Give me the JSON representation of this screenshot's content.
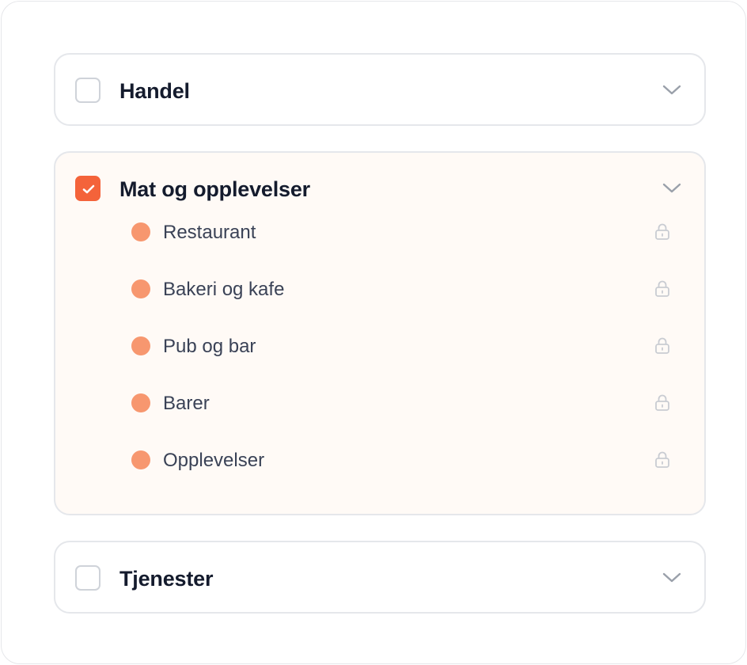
{
  "groups": [
    {
      "title": "Handel",
      "checked": false,
      "expanded": false
    },
    {
      "title": "Mat og opplevelser",
      "checked": true,
      "expanded": true,
      "items": [
        {
          "label": "Restaurant"
        },
        {
          "label": "Bakeri og kafe"
        },
        {
          "label": "Pub og bar"
        },
        {
          "label": "Barer"
        },
        {
          "label": "Opplevelser"
        }
      ]
    },
    {
      "title": "Tjenester",
      "checked": false,
      "expanded": false
    }
  ],
  "icons": {
    "checkbox": "checkbox-icon",
    "check": "check-icon",
    "chevron": "chevron-down-icon",
    "lock": "lock-icon",
    "dot": "category-dot-icon"
  },
  "colors": {
    "accent": "#f4633a",
    "dot": "#f7976f",
    "expanded_bg": "#fffaf6",
    "border": "#e5e7eb",
    "title": "#141b2d",
    "text": "#3a4256",
    "lock": "#c9ccd2",
    "chevron": "#9aa0aa"
  }
}
